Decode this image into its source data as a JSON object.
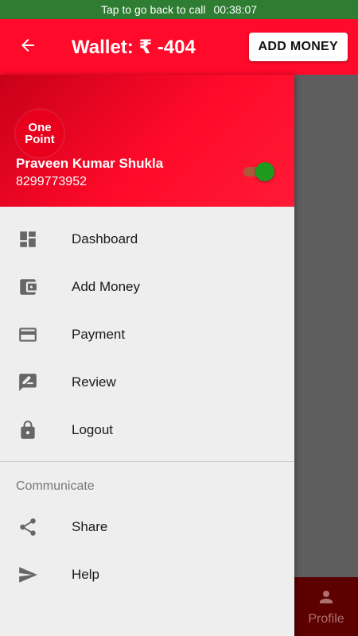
{
  "status_bar": {
    "text": "Tap to go back to call",
    "timer": "00:38:07",
    "color": "#2e7d32"
  },
  "app_bar": {
    "title": "Wallet: ₹ -404",
    "action_label": "ADD MONEY",
    "back_icon": "arrow-back-icon",
    "color": "#ff0a2a"
  },
  "drawer": {
    "logo_line1": "One",
    "logo_line2": "Point",
    "user_name": "Praveen Kumar Shukla",
    "user_phone": "8299773952",
    "toggle_on": true,
    "items": [
      {
        "label": "Dashboard",
        "icon": "dashboard-icon"
      },
      {
        "label": "Add Money",
        "icon": "wallet-icon"
      },
      {
        "label": "Payment",
        "icon": "credit-card-icon"
      },
      {
        "label": "Review",
        "icon": "rate-review-icon"
      },
      {
        "label": "Logout",
        "icon": "lock-icon"
      }
    ],
    "section_title": "Communicate",
    "section_items": [
      {
        "label": "Share",
        "icon": "share-icon"
      },
      {
        "label": "Help",
        "icon": "send-icon"
      }
    ]
  },
  "bottom_nav": {
    "profile_label": "Profile",
    "icon": "person-icon"
  }
}
